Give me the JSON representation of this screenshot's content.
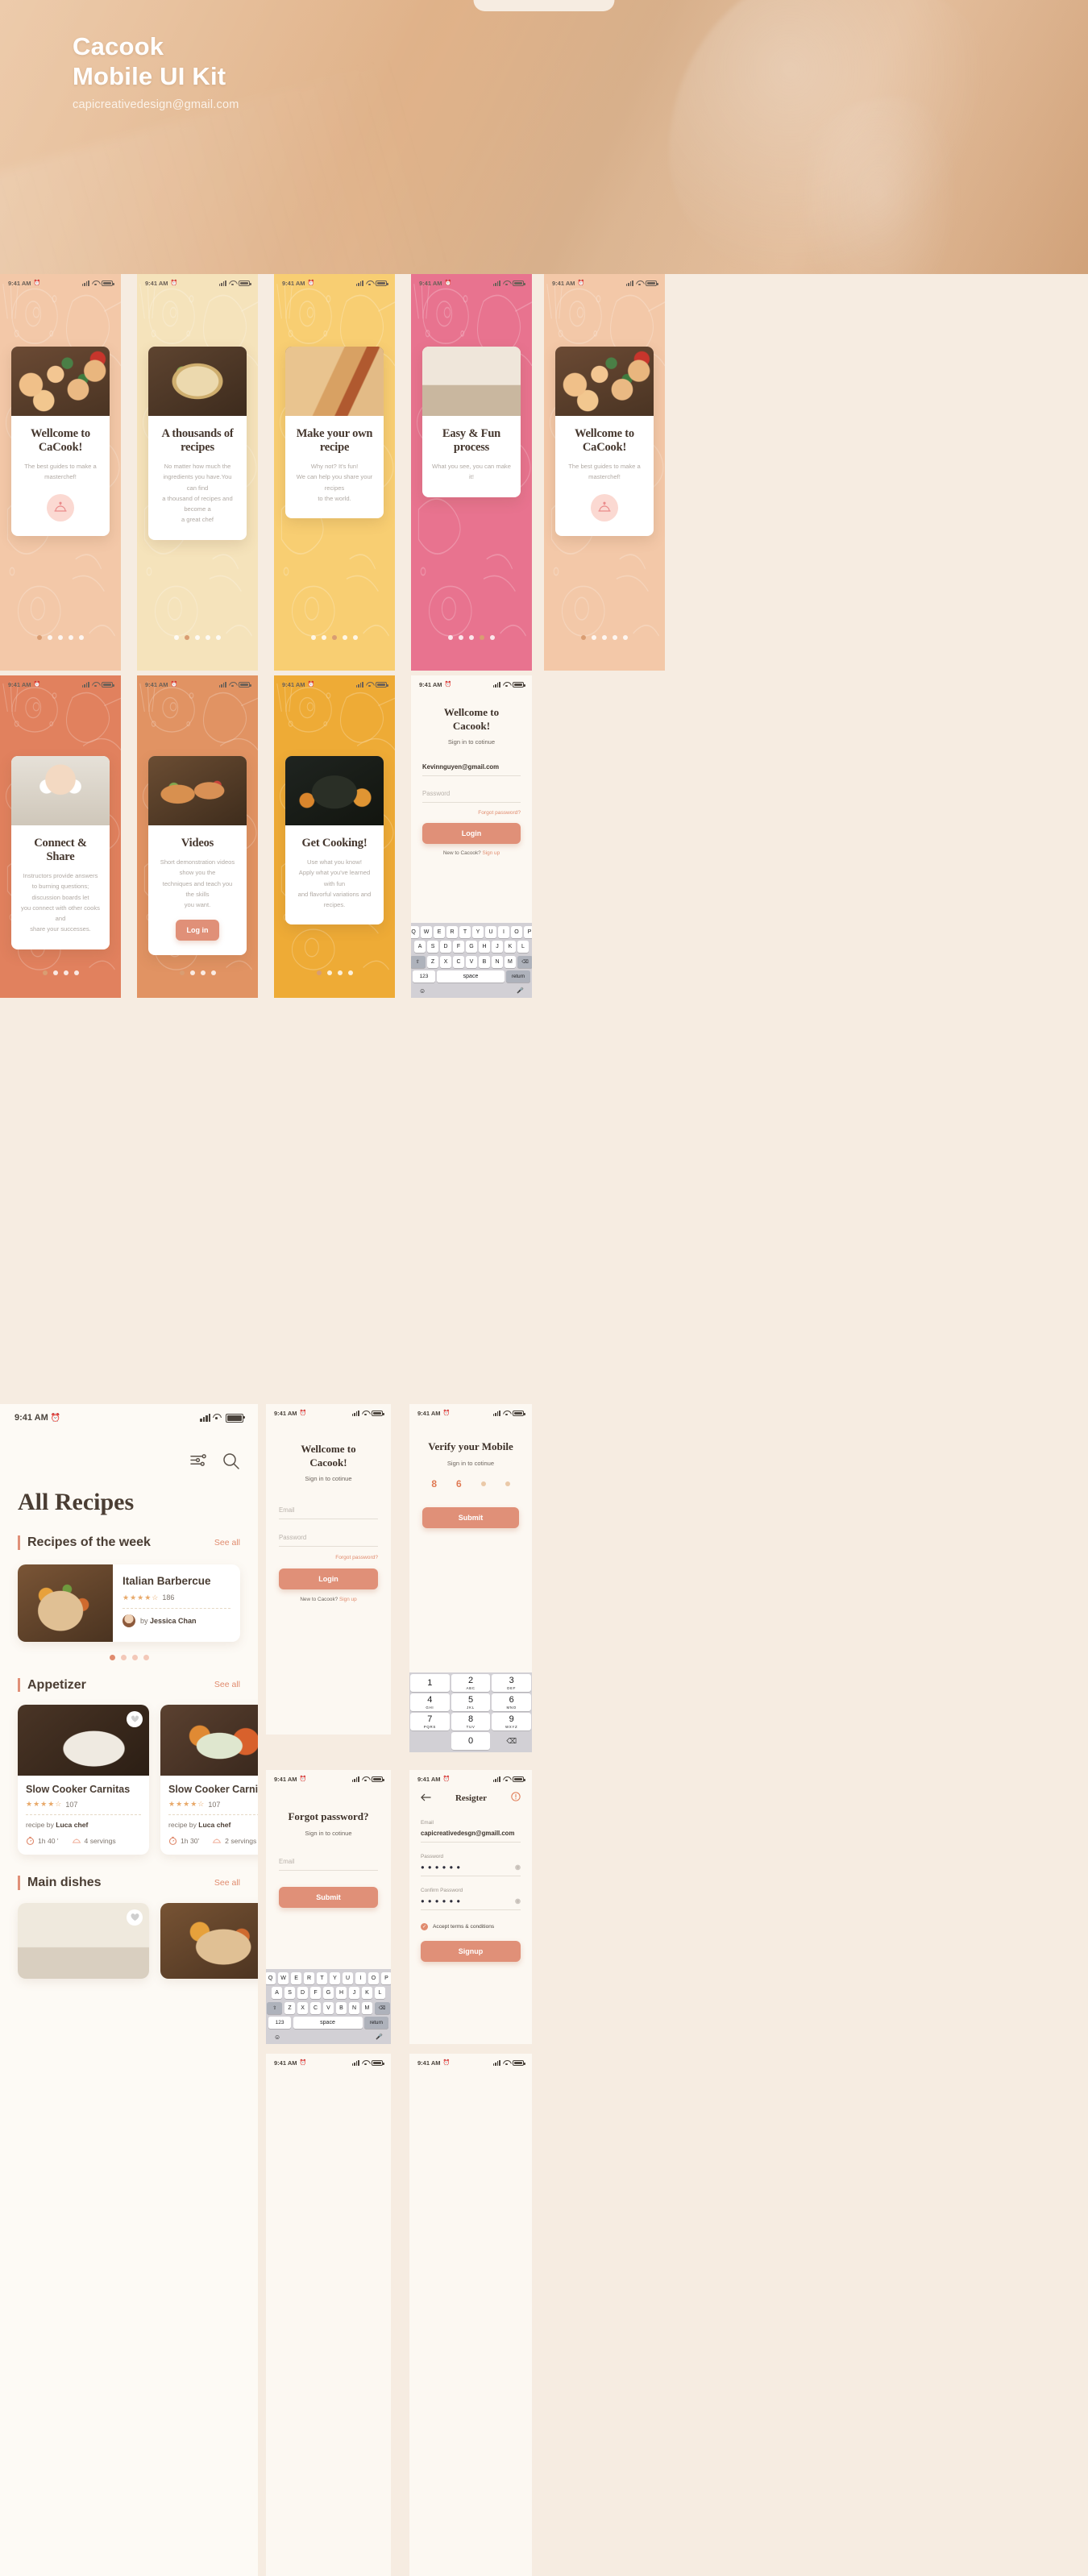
{
  "hero": {
    "title_line1": "Cacook",
    "title_line2": "Mobile UI Kit",
    "email": "capicreativedesign@gmail.com"
  },
  "status_bar": {
    "time": "9:41 AM",
    "alarm_icon": "alarm-icon"
  },
  "onboarding": [
    {
      "title": "Wellcome to CaCook!",
      "body": "The best guides to make a masterchef!",
      "bg": "#f3c8a8",
      "dots": 5,
      "active": 0,
      "photo": "pasta",
      "badge_icon": "cloche-icon"
    },
    {
      "title": "A thousands of recipes",
      "body": "No matter how much the\ningredients you have.You can find\na thousand of recipes and become a\na great chef",
      "bg": "#f5e3bb",
      "dots": 5,
      "active": 1,
      "photo": "soup"
    },
    {
      "title": "Make your own recipe",
      "body": "Why not? It's fun!\nWe can help you share your recipes\nto the world.",
      "bg": "#f8ce72",
      "dots": 5,
      "active": 2,
      "photo": "wrap"
    },
    {
      "title": "Easy & Fun process",
      "body": "What you see, you can make it!",
      "bg": "#e8738f",
      "dots": 5,
      "active": 3,
      "photo": "kitchen"
    },
    {
      "title": "Connect & Share",
      "body": "Instructors provide answers\nto burning questions; discussion boards let\nyou connect with other cooks and\nshare your successes.",
      "bg": "#e1815e",
      "dots": 4,
      "active": 0,
      "photo": "girl"
    },
    {
      "title": "Videos",
      "body": "Short demonstration videos show you the\ntechniques and teach you the skills\nyou want.",
      "bg": "#e19363",
      "dots": 4,
      "active": 0,
      "photo": "toast",
      "button": "Log in"
    },
    {
      "title": "Get Cooking!",
      "body": "Use what you know!\nApply what you've learned with fun\nand flavorful variations and recipes.",
      "bg": "#eeab36",
      "dots": 4,
      "active": 0,
      "photo": "pumpkin"
    }
  ],
  "login": {
    "title": "Wellcome to\nCacook!",
    "subtitle": "Sign in to cotinue",
    "email_value": "Kevinnguyen@gmail.com",
    "email_placeholder": "Email",
    "password_placeholder": "Password",
    "forgot": "Forgot password?",
    "login_button": "Login",
    "new_prompt": "New to Cacook?",
    "signup_link": "Sign up"
  },
  "verify": {
    "title": "Verify your Mobile",
    "subtitle": "Sign in to cotinue",
    "code": [
      "8",
      "6",
      "",
      ""
    ],
    "submit": "Submit"
  },
  "forgot": {
    "title": "Forgot password?",
    "subtitle": "Sign in to cotinue",
    "email_placeholder": "Email",
    "submit": "Submit"
  },
  "register": {
    "title": "Resigter",
    "back_icon": "arrow-left-icon",
    "info_icon": "info-circle-icon",
    "email_label": "Email",
    "email_value": "capicreativedesgn@gmaill.com",
    "password_label": "Password",
    "password_value": "● ● ● ● ● ●",
    "confirm_label": "Confirm Password",
    "confirm_value": "● ● ● ● ● ●",
    "terms": "Accept terms & conditions",
    "signup_button": "Signup"
  },
  "keyboard": {
    "row1": [
      "Q",
      "W",
      "E",
      "R",
      "T",
      "Y",
      "U",
      "I",
      "O",
      "P"
    ],
    "row2": [
      "A",
      "S",
      "D",
      "F",
      "G",
      "H",
      "J",
      "K",
      "L"
    ],
    "row3": [
      "Z",
      "X",
      "C",
      "V",
      "B",
      "N",
      "M"
    ],
    "shift": "⇧",
    "backspace": "⌫",
    "numbers": "123",
    "space": "space",
    "return": "return",
    "emoji": "☺",
    "mic": "🎤"
  },
  "numpad": [
    {
      "n": "1",
      "s": ""
    },
    {
      "n": "2",
      "s": "ABC"
    },
    {
      "n": "3",
      "s": "DEF"
    },
    {
      "n": "4",
      "s": "GHI"
    },
    {
      "n": "5",
      "s": "JKL"
    },
    {
      "n": "6",
      "s": "MNO"
    },
    {
      "n": "7",
      "s": "PQRS"
    },
    {
      "n": "8",
      "s": "TUV"
    },
    {
      "n": "9",
      "s": "WXYZ"
    },
    {
      "n": "0",
      "s": ""
    }
  ],
  "recipes": {
    "page_title": "All Recipes",
    "filter_icon": "sliders-icon",
    "search_icon": "search-icon",
    "sections": [
      {
        "title": "Recipes of the week",
        "see_all": "See all"
      },
      {
        "title": "Appetizer",
        "see_all": "See all"
      },
      {
        "title": "Main dishes",
        "see_all": "See all"
      }
    ],
    "featured": {
      "name": "Italian Barbercue",
      "stars": 4,
      "reviews": "186",
      "by_prefix": "by",
      "author": "Jessica Chan",
      "dots": 4,
      "active_dot": 0
    },
    "cards": [
      {
        "name": "Slow Cooker Carnitas",
        "stars": 4,
        "reviews": "107",
        "by_prefix": "recipe by",
        "author": "Luca chef",
        "time": "1h 40 '",
        "servings": "4 servings",
        "photo": "carnitas",
        "badge": "heart-icon"
      },
      {
        "name": "Slow Cooker Carnitas",
        "stars": 4,
        "reviews": "107",
        "by_prefix": "recipe by",
        "author": "Luca chef",
        "time": "1h 30'",
        "servings": "2 servings",
        "photo": "carnitas2",
        "badge": "video-icon"
      }
    ],
    "main_cards": [
      {
        "photo": "main1",
        "badge": "heart-icon"
      },
      {
        "photo": "main2",
        "badge": ""
      }
    ]
  },
  "colors": {
    "accent": "#e09078",
    "accent_light": "#f3c8a8",
    "text_dark": "#44362d",
    "text_muted": "#b1aaa4",
    "page_bg": "#f6ece1",
    "star": "#e8a96a"
  }
}
